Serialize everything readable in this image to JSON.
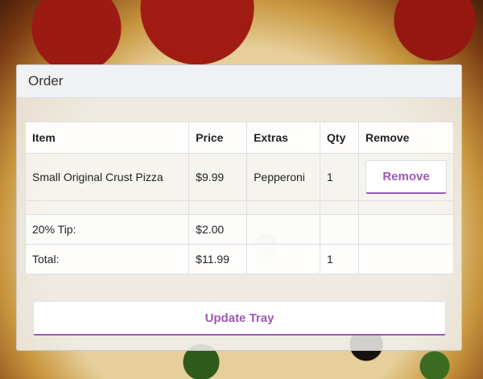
{
  "panel": {
    "title": "Order"
  },
  "table": {
    "headers": [
      "Item",
      "Price",
      "Extras",
      "Qty",
      "Remove"
    ],
    "item": {
      "name": "Small Original Crust Pizza",
      "price": "$9.99",
      "extras": "Pepperoni",
      "qty": "1",
      "remove_label": "Remove"
    },
    "tip": {
      "label": "20% Tip:",
      "value": "$2.00"
    },
    "total": {
      "label": "Total:",
      "value": "$11.99",
      "qty": "1"
    }
  },
  "actions": {
    "update_label": "Update Tray"
  },
  "colors": {
    "accent": "#9b59b6"
  }
}
